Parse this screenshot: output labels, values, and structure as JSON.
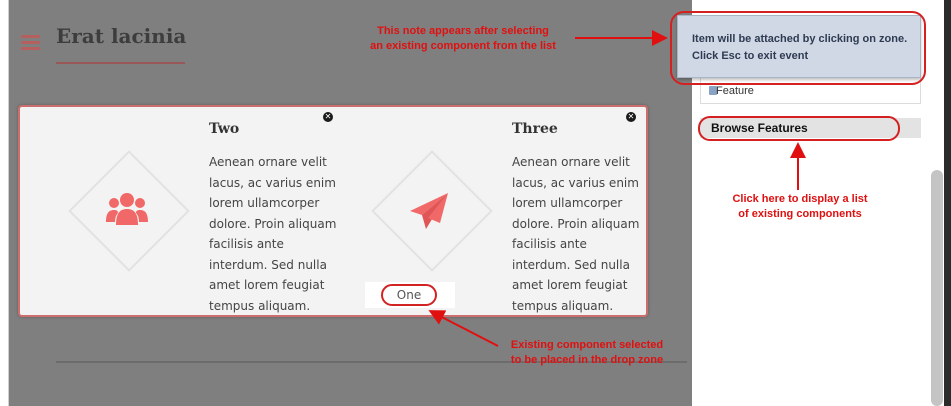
{
  "page": {
    "title": "Erat lacinia"
  },
  "drop_zone": {
    "features": [
      {
        "title": "Two",
        "icon": "users-icon",
        "text": "Aenean ornare velit lacus, ac varius enim lorem ullamcorper dolore. Proin aliquam facilisis ante interdum. Sed nulla amet lorem feugiat tempus aliquam."
      },
      {
        "title": "Three",
        "icon": "paper-plane-icon",
        "text": "Aenean ornare velit lacus, ac varius enim lorem ullamcorper dolore. Proin aliquam facilisis ante interdum. Sed nulla amet lorem feugiat tempus aliquam."
      }
    ],
    "selected_component_label": "One"
  },
  "sidebar": {
    "note": {
      "line1": "Item will be attached by clicking on zone.",
      "line2": "Click Esc to exit event"
    },
    "feature_item_label": "Feature",
    "browse_button_label": "Browse Features"
  },
  "annotations": {
    "note_callout": {
      "line1": "This note appears after selecting",
      "line2": "an existing component from the list"
    },
    "browse_callout": {
      "line1": "Click here to display a list",
      "line2": "of existing components"
    },
    "component_callout": {
      "line1": "Existing component selected",
      "line2": "to be placed in the drop zone"
    }
  },
  "colors": {
    "annotation_red": "#e01010",
    "accent_coral": "#f06868",
    "overlay_gray": "#7f7f7f",
    "note_blue": "#cfd8e4"
  }
}
